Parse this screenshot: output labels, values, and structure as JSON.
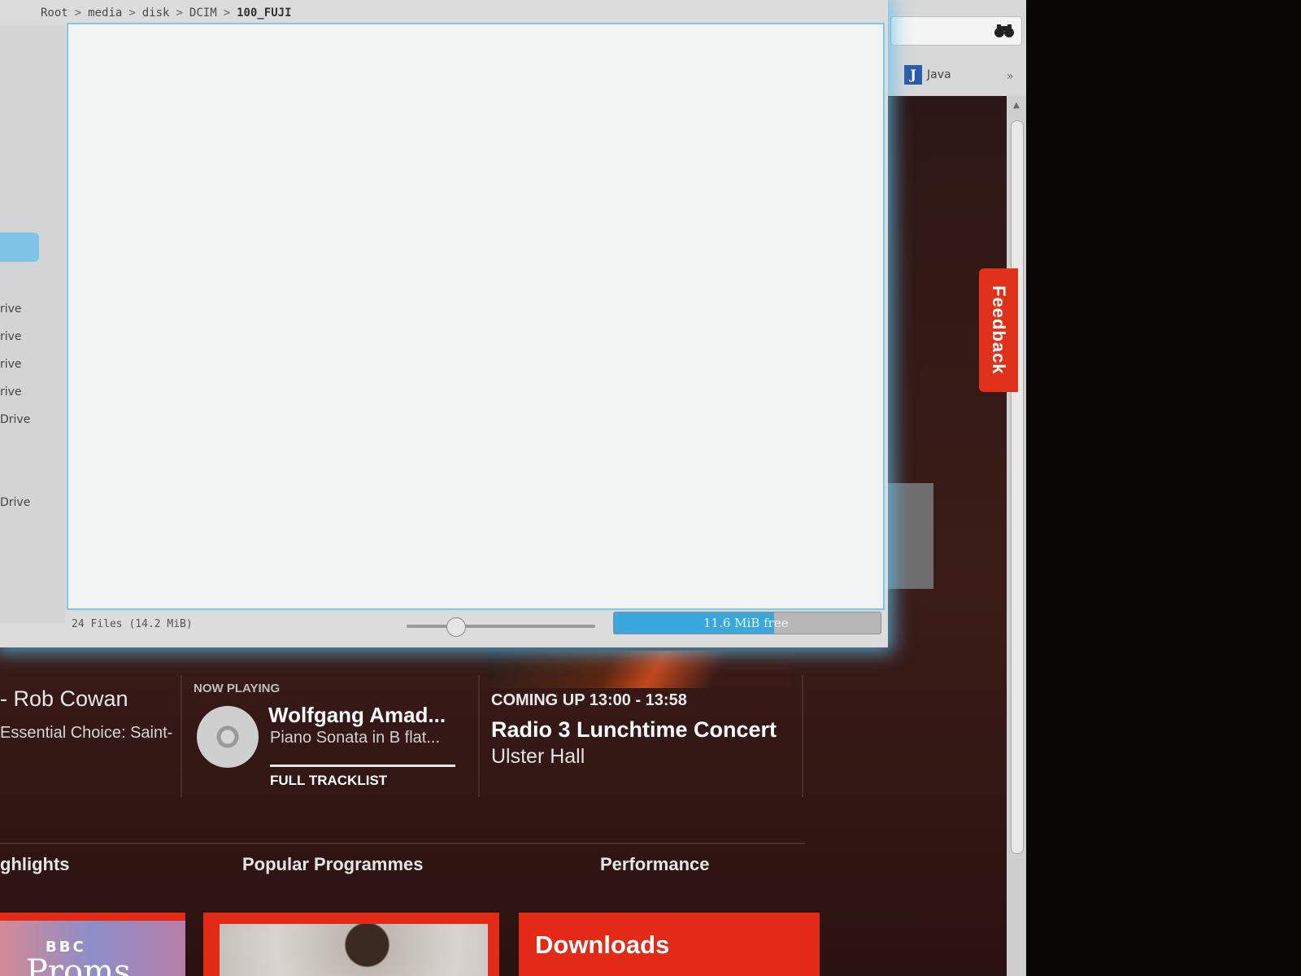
{
  "browser": {
    "bookmark_label": "Java",
    "bookmark_icon": "J",
    "more_bookmarks": "»",
    "feedback_label": "Feedback"
  },
  "now_playing": {
    "previous_title": "- Rob Cowan",
    "previous_subtitle": "Essential Choice: Saint-",
    "label": "NOW PLAYING",
    "track": "Wolfgang Amad...",
    "piece": "Piano Sonata in B flat...",
    "tracklist_link": "FULL TRACKLIST"
  },
  "coming_up": {
    "label": "COMING UP 13:00 - 13:58",
    "title": "Radio 3 Lunchtime Concert",
    "venue": "Ulster Hall"
  },
  "sections": {
    "highlights": "ghlights",
    "popular": "Popular Programmes",
    "performance": "Performance"
  },
  "tiles": {
    "bbc_logo": "BBC",
    "proms": "Proms",
    "downloads": "Downloads"
  },
  "file_manager": {
    "breadcrumb": [
      "Root",
      "media",
      "disk",
      "DCIM",
      "100_FUJI"
    ],
    "places": [
      "rive",
      "rive",
      "rive",
      "rive",
      "Drive",
      "Drive"
    ],
    "status_text": "24 Files (14.2 MiB)",
    "zoom_level": 0.26,
    "free_space_text": "11.6 MiB free",
    "used_fraction": 0.6
  },
  "colors": {
    "accent_red": "#e32a16",
    "selection_blue": "#3aa8dc",
    "window_glow": "#5abeeb"
  }
}
